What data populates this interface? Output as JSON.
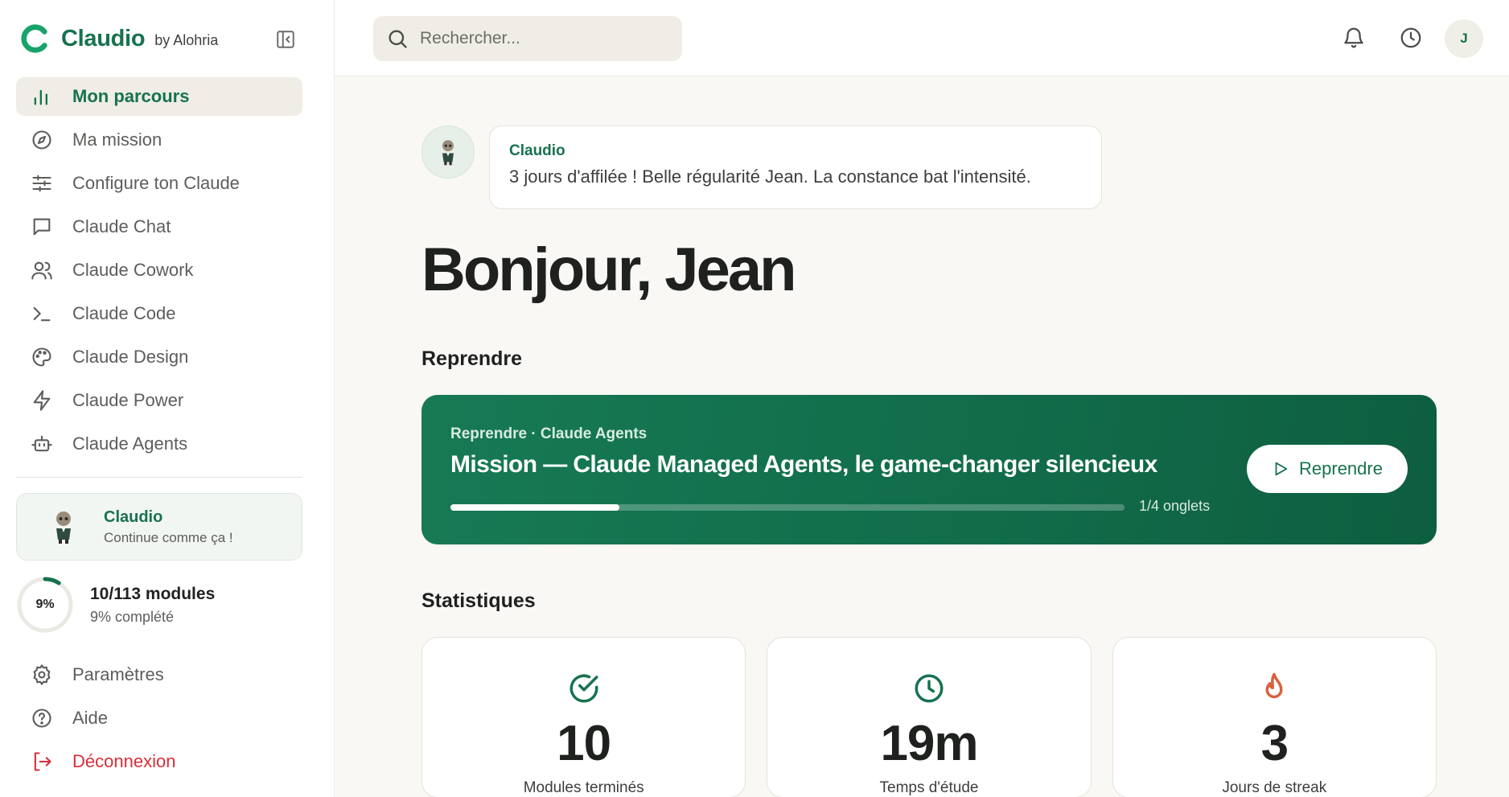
{
  "brand": {
    "name": "Claudio",
    "by": "by Alohria"
  },
  "nav": {
    "items": [
      {
        "label": "Mon parcours",
        "icon": "bar-chart-icon",
        "active": true
      },
      {
        "label": "Ma mission",
        "icon": "compass-icon"
      },
      {
        "label": "Configure ton Claude",
        "icon": "sliders-icon"
      },
      {
        "label": "Claude Chat",
        "icon": "chat-bubble-icon"
      },
      {
        "label": "Claude Cowork",
        "icon": "users-icon"
      },
      {
        "label": "Claude Code",
        "icon": "terminal-icon"
      },
      {
        "label": "Claude Design",
        "icon": "palette-icon"
      },
      {
        "label": "Claude Power",
        "icon": "lightning-icon"
      },
      {
        "label": "Claude Agents",
        "icon": "robot-icon"
      }
    ]
  },
  "mascot_card": {
    "title": "Claudio",
    "subtitle": "Continue comme ça !"
  },
  "progress": {
    "percent_label": "9%",
    "percent": 9,
    "modules": "10/113 modules",
    "completed": "9% complété"
  },
  "bottom_nav": {
    "settings": "Paramètres",
    "help": "Aide",
    "logout": "Déconnexion"
  },
  "topbar": {
    "search_placeholder": "Rechercher...",
    "avatar_initial": "J"
  },
  "greeting": {
    "bubble_name": "Claudio",
    "bubble_text": "3 jours d'affilée ! Belle régularité Jean. La constance bat l'intensité.",
    "title": "Bonjour, Jean"
  },
  "resume": {
    "section_title": "Reprendre",
    "eyebrow": "Reprendre · Claude Agents",
    "title": "Mission — Claude Managed Agents, le game-changer silencieux",
    "progress_fraction": 0.25,
    "tabs_label": "1/4 onglets",
    "button_label": "Reprendre"
  },
  "stats": {
    "section_title": "Statistiques",
    "cards": [
      {
        "value": "10",
        "label": "Modules terminés",
        "icon": "check-circle-icon"
      },
      {
        "value": "19m",
        "label": "Temps d'étude",
        "icon": "clock-icon"
      },
      {
        "value": "3",
        "label": "Jours de streak",
        "icon": "flame-icon"
      }
    ]
  },
  "colors": {
    "brand_green": "#17724f",
    "danger": "#d62f3a",
    "flame": "#d9603e"
  }
}
